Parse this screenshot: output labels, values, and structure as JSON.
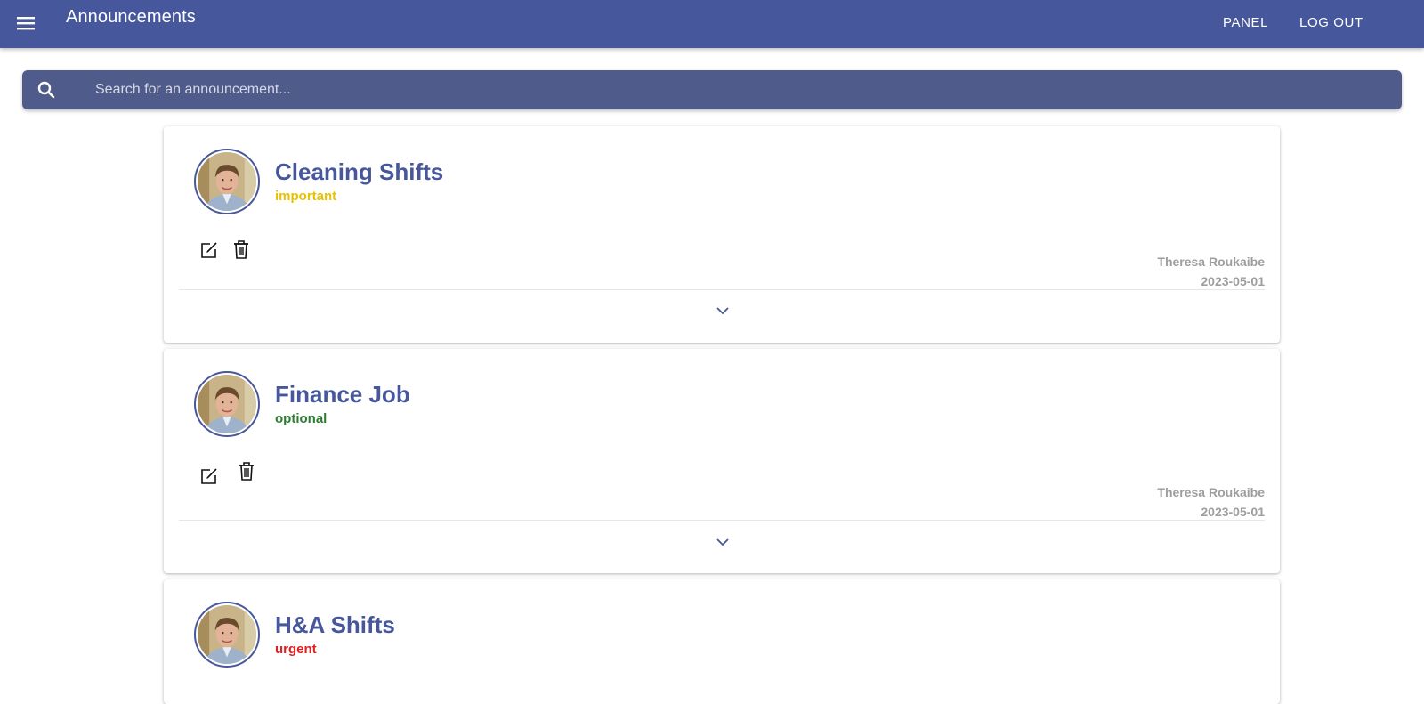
{
  "header": {
    "title": "Announcements",
    "nav": [
      {
        "label": "PANEL"
      },
      {
        "label": "LOG OUT"
      }
    ]
  },
  "search": {
    "placeholder": "Search for an announcement...",
    "value": ""
  },
  "announcements": [
    {
      "title": "Cleaning Shifts",
      "priority": "important",
      "priority_color": "#e6c200",
      "author": "Theresa Roukaibe",
      "date": "2023-05-01"
    },
    {
      "title": "Finance Job",
      "priority": "optional",
      "priority_color": "#2e7d32",
      "author": "Theresa Roukaibe",
      "date": "2023-05-01"
    },
    {
      "title": "H&A Shifts",
      "priority": "urgent",
      "priority_color": "#e02020",
      "author": "",
      "date": ""
    }
  ],
  "icons": {
    "menu": "menu-icon",
    "search": "search-icon",
    "edit": "edit-icon",
    "delete": "trash-icon",
    "expand": "chevron-down-icon"
  },
  "colors": {
    "primary": "#47579b",
    "search_bg": "#4f5b8b",
    "meta_text": "#9e9e9e"
  }
}
